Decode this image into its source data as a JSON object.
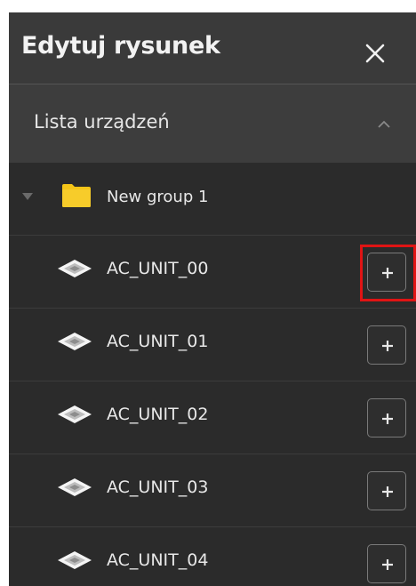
{
  "header": {
    "title": "Edytuj rysunek",
    "close_icon": "close-icon"
  },
  "section": {
    "title": "Lista urządzeń",
    "chevron_icon": "chevron-up-icon",
    "expanded": true
  },
  "group": {
    "label": "New group 1",
    "folder_icon": "folder-icon",
    "folder_color": "#f5c518",
    "expand_icon": "caret-down-icon"
  },
  "devices": [
    {
      "label": "AC_UNIT_00",
      "add_icon": "plus-icon",
      "highlighted": true
    },
    {
      "label": "AC_UNIT_01",
      "add_icon": "plus-icon",
      "highlighted": false
    },
    {
      "label": "AC_UNIT_02",
      "add_icon": "plus-icon",
      "highlighted": false
    },
    {
      "label": "AC_UNIT_03",
      "add_icon": "plus-icon",
      "highlighted": false
    },
    {
      "label": "AC_UNIT_04",
      "add_icon": "plus-icon",
      "highlighted": false
    }
  ],
  "colors": {
    "panel_bg": "#3a3a3a",
    "list_bg": "#2b2b2b",
    "text": "#e8e8e8",
    "highlight": "#e01414",
    "folder": "#f5c518"
  }
}
